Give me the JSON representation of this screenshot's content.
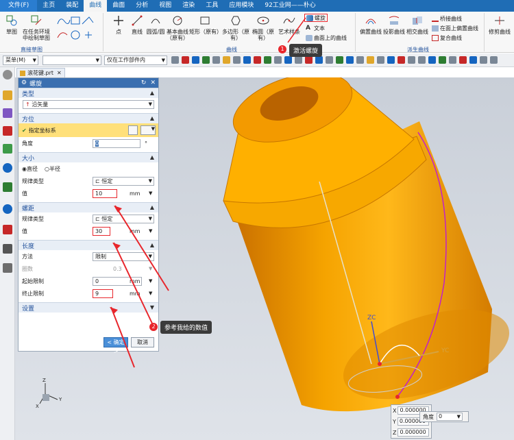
{
  "menu": {
    "file": "文件(F)",
    "items": [
      "主页",
      "装配",
      "曲线",
      "曲面",
      "分析",
      "视图",
      "渲染",
      "工具",
      "应用模块",
      "92工业网——朴心"
    ],
    "active_index": 2
  },
  "ribbon": {
    "sketch": "草图",
    "sketch_in_env": "在任务环境\n中绘制草图",
    "group_direct_sketch": "直接草图",
    "point": "点",
    "line": "直线",
    "arc_circle": "圆弧/圆",
    "basic_curve": "基本曲线\n（原有）",
    "rectangle": "矩形（原有）",
    "polygon": "多边形（原有）",
    "ellipse": "椭圆（原有）",
    "art_spline": "艺术样条",
    "helix": "螺旋",
    "text": "文本",
    "curve_on_surface": "曲面上的曲线",
    "group_curve": "曲线",
    "offset_curve": "偏置曲线",
    "projection_curve": "投影曲线",
    "intersection_curve": "相交曲线",
    "bridge_curve": "桥接曲线",
    "offset_on_face": "在面上偏置曲线",
    "composite_curve": "复合曲线",
    "group_derived": "派生曲线",
    "trim_curve": "修剪曲线"
  },
  "toolbar": {
    "menu": "菜单(M)",
    "filter_value": "",
    "scope_value": "仅在工作部件内"
  },
  "tab": {
    "label": "滚花键.prt"
  },
  "dialog": {
    "title": "螺旋",
    "type_section": "类型",
    "type_value": "沿矢量",
    "orient_section": "方位",
    "specify_csys": "指定坐标系",
    "angle_label": "角度",
    "angle_value": "0",
    "angle_unit": "°",
    "size_section": "大小",
    "radio_diameter": "直径",
    "radio_radius": "半径",
    "law_type_label": "规律类型",
    "law_type_value": "恒定",
    "value_label": "值",
    "size_value": "10",
    "unit_mm": "mm",
    "pitch_section": "螺距",
    "pitch_law_label": "规律类型",
    "pitch_law_value": "恒定",
    "pitch_value_label": "值",
    "pitch_value": "30",
    "length_section": "长度",
    "method_label": "方法",
    "method_value": "限制",
    "turns_label": "圈数",
    "turns_value": "0.3",
    "start_label": "起始限制",
    "start_value": "0",
    "end_label": "终止限制",
    "end_value": "9",
    "settings_section": "设置",
    "ok_button": "< 确定 >",
    "cancel_button": "取消"
  },
  "annotations": {
    "badge1": "1",
    "tip1": "激活螺旋",
    "badge2": "2",
    "tip2": "参考我给的数值"
  },
  "viewport": {
    "zc_label": "ZC",
    "yc_label": "YC",
    "triad_z": "Z",
    "triad_y": "Y",
    "triad_x": "X",
    "coord_x_label": "X",
    "coord_x_value": "0.000000",
    "coord_y_label": "Y",
    "coord_y_value": "0.000000",
    "coord_z_label": "Z",
    "coord_z_value": "0.000000",
    "angle_label": "角度",
    "angle_value": "0"
  }
}
